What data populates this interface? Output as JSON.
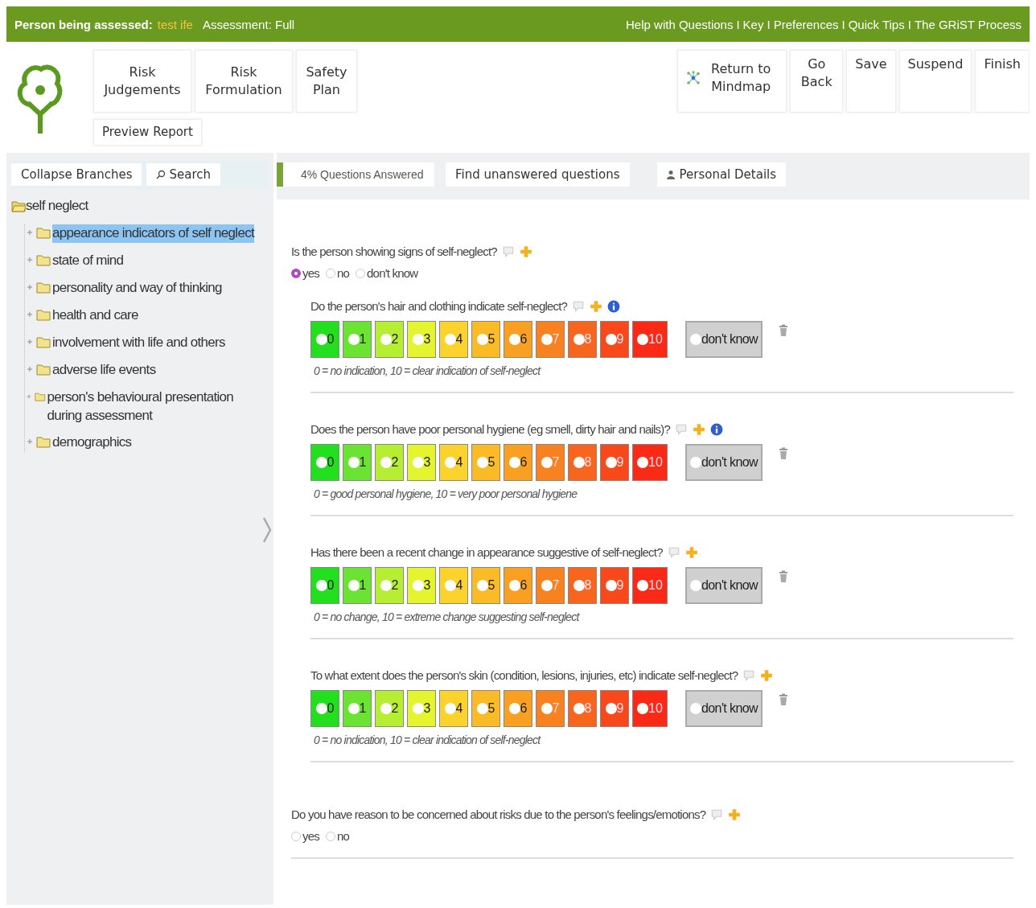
{
  "top_bar": {
    "person_label": "Person being assessed:",
    "person_name": "test ife",
    "assessment": "Assessment: Full",
    "links": [
      "Help with Questions",
      "Key",
      "Preferences",
      "Quick Tips",
      "The GRiST Process"
    ],
    "separators": [
      "I",
      "I",
      "I",
      "I"
    ]
  },
  "nav_buttons": [
    {
      "label": "Risk Judgements"
    },
    {
      "label": "Risk Formulation"
    },
    {
      "label": "Safety Plan"
    }
  ],
  "preview_button": "Preview Report",
  "action_buttons": [
    {
      "kind": "mindmap",
      "label": "Return to Mindmap"
    },
    {
      "kind": "plain",
      "label": "Go Back"
    },
    {
      "kind": "plain",
      "label": "Save"
    },
    {
      "kind": "plain",
      "label": "Suspend"
    },
    {
      "kind": "plain",
      "label": "Finish"
    }
  ],
  "sidebar": {
    "buttons": [
      {
        "kind": "plain",
        "label": "Collapse Branches"
      },
      {
        "kind": "search",
        "label": "Search"
      }
    ],
    "tree": [
      {
        "label": "self neglect",
        "expanded": true,
        "selected": false,
        "children": [
          {
            "label": "appearance indicators of self neglect",
            "expanded": false,
            "selected": true
          },
          {
            "label": "state of mind",
            "expanded": false,
            "selected": false
          },
          {
            "label": "personality and way of thinking",
            "expanded": false,
            "selected": false
          },
          {
            "label": "health and care",
            "expanded": false,
            "selected": false
          },
          {
            "label": "involvement with life and others",
            "expanded": false,
            "selected": false
          },
          {
            "label": "adverse life events",
            "expanded": false,
            "selected": false
          },
          {
            "label": "person's behavioural presentation during assessment",
            "expanded": false,
            "selected": false
          },
          {
            "label": "demographics",
            "expanded": false,
            "selected": false
          }
        ]
      }
    ]
  },
  "toolbar": {
    "progress": {
      "label": "4% Questions Answered",
      "level": 0.04
    },
    "find_button": "Find unanswered questions",
    "details_button": "Personal Details"
  },
  "questions": [
    {
      "kind": "radio",
      "text": "Is the person showing signs of self-neglect?",
      "info": false,
      "options": [
        {
          "label": "yes",
          "selected": true
        },
        {
          "label": "no",
          "selected": false
        },
        {
          "label": "don't know",
          "selected": false
        }
      ]
    },
    {
      "kind": "scale",
      "text": "Do the person's hair and clothing indicate self-neglect?",
      "info": true,
      "dont_know": "don't know",
      "legend": "0 = no indication, 10 = clear indication of self-neglect",
      "options": [
        {
          "label": "0",
          "color": "#22e01e",
          "selected": false
        },
        {
          "label": "1",
          "color": "#6be332",
          "selected": false
        },
        {
          "label": "2",
          "color": "#b5ee32",
          "selected": false
        },
        {
          "label": "3",
          "color": "#e4f530",
          "selected": false
        },
        {
          "label": "4",
          "color": "#fcd22c",
          "selected": false
        },
        {
          "label": "5",
          "color": "#fbbb27",
          "selected": false
        },
        {
          "label": "6",
          "color": "#f9a022",
          "selected": false
        },
        {
          "label": "7",
          "color": "#f88120",
          "selected": false
        },
        {
          "label": "8",
          "color": "#f8661d",
          "selected": false
        },
        {
          "label": "9",
          "color": "#f9481a",
          "selected": false
        },
        {
          "label": "10",
          "color": "#fb2a16",
          "selected": false
        }
      ]
    },
    {
      "kind": "scale",
      "text": "Does the person have poor personal hygiene (eg smell, dirty hair and nails)?",
      "info": true,
      "dont_know": "don't know",
      "legend": "0 = good personal hygiene, 10 = very poor personal hygiene",
      "options": [
        {
          "label": "0",
          "color": "#22e01e",
          "selected": false
        },
        {
          "label": "1",
          "color": "#6be332",
          "selected": false
        },
        {
          "label": "2",
          "color": "#b5ee32",
          "selected": false
        },
        {
          "label": "3",
          "color": "#e4f530",
          "selected": false
        },
        {
          "label": "4",
          "color": "#fcd22c",
          "selected": false
        },
        {
          "label": "5",
          "color": "#fbbb27",
          "selected": false
        },
        {
          "label": "6",
          "color": "#f9a022",
          "selected": false
        },
        {
          "label": "7",
          "color": "#f88120",
          "selected": false
        },
        {
          "label": "8",
          "color": "#f8661d",
          "selected": false
        },
        {
          "label": "9",
          "color": "#f9481a",
          "selected": false
        },
        {
          "label": "10",
          "color": "#fb2a16",
          "selected": false
        }
      ]
    },
    {
      "kind": "scale",
      "text": "Has there been a recent change in appearance suggestive of self-neglect?",
      "info": false,
      "dont_know": "don't know",
      "legend": "0 = no change, 10 = extreme change suggesting self-neglect",
      "options": [
        {
          "label": "0",
          "color": "#22e01e",
          "selected": false
        },
        {
          "label": "1",
          "color": "#6be332",
          "selected": false
        },
        {
          "label": "2",
          "color": "#b5ee32",
          "selected": false
        },
        {
          "label": "3",
          "color": "#e4f530",
          "selected": false
        },
        {
          "label": "4",
          "color": "#fcd22c",
          "selected": false
        },
        {
          "label": "5",
          "color": "#fbbb27",
          "selected": false
        },
        {
          "label": "6",
          "color": "#f9a022",
          "selected": false
        },
        {
          "label": "7",
          "color": "#f88120",
          "selected": false
        },
        {
          "label": "8",
          "color": "#f8661d",
          "selected": false
        },
        {
          "label": "9",
          "color": "#f9481a",
          "selected": false
        },
        {
          "label": "10",
          "color": "#fb2a16",
          "selected": false
        }
      ]
    },
    {
      "kind": "scale",
      "text": "To what extent does the person's skin (condition, lesions, injuries, etc) indicate self-neglect?",
      "info": false,
      "dont_know": "don't know",
      "legend": "0 = no indication, 10 = clear indication of self-neglect",
      "options": [
        {
          "label": "0",
          "color": "#22e01e",
          "selected": false
        },
        {
          "label": "1",
          "color": "#6be332",
          "selected": false
        },
        {
          "label": "2",
          "color": "#b5ee32",
          "selected": false
        },
        {
          "label": "3",
          "color": "#e4f530",
          "selected": false
        },
        {
          "label": "4",
          "color": "#fcd22c",
          "selected": false
        },
        {
          "label": "5",
          "color": "#fbbb27",
          "selected": false
        },
        {
          "label": "6",
          "color": "#f9a022",
          "selected": false
        },
        {
          "label": "7",
          "color": "#f88120",
          "selected": false
        },
        {
          "label": "8",
          "color": "#f8661d",
          "selected": false
        },
        {
          "label": "9",
          "color": "#f9481a",
          "selected": false
        },
        {
          "label": "10",
          "color": "#fb2a16",
          "selected": false
        }
      ]
    },
    {
      "kind": "radio",
      "text": "Do you have reason to be concerned about risks due to the person's feelings/emotions?",
      "info": false,
      "options": [
        {
          "label": "yes",
          "selected": false
        },
        {
          "label": "no",
          "selected": false
        }
      ]
    }
  ]
}
